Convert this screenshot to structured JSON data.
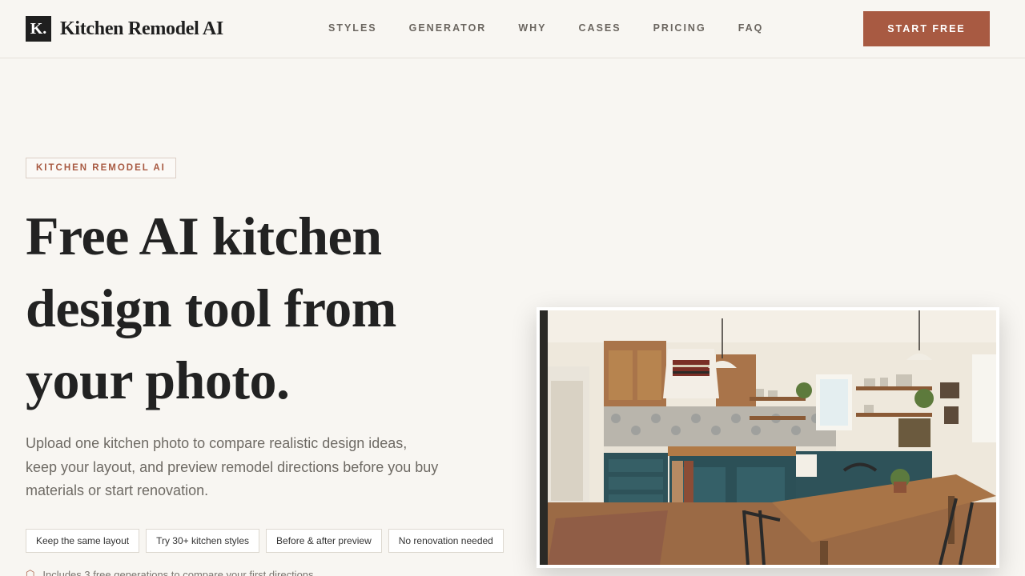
{
  "brand": {
    "mark": "K.",
    "name": "Kitchen Remodel AI"
  },
  "nav": {
    "links": [
      "STYLES",
      "GENERATOR",
      "WHY",
      "CASES",
      "PRICING",
      "FAQ"
    ],
    "cta_label": "START FREE"
  },
  "hero": {
    "eyebrow": "KITCHEN REMODEL AI",
    "headline_lines": [
      "Free AI kitchen",
      "design tool from",
      "your photo."
    ],
    "subtext": "Upload one kitchen photo to compare realistic design ideas, keep your layout, and preview remodel directions before you buy materials or start renovation.",
    "chips": [
      "Keep the same layout",
      "Try 30+ kitchen styles",
      "Before & after preview",
      "No renovation needed"
    ],
    "note": "Includes 3 free generations to compare your first directions",
    "image_icon": "kitchen-photo"
  },
  "colors": {
    "accent": "#a85a42",
    "background": "#f8f6f2",
    "text": "#222222"
  }
}
